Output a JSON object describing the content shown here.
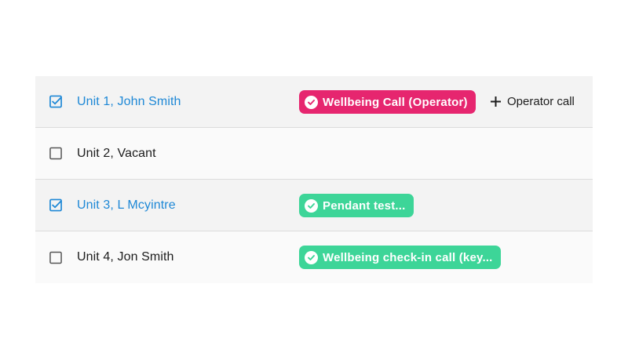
{
  "colors": {
    "accent_blue": "#1e88d6",
    "tag_pink": "#e6266f",
    "tag_green": "#3dd598",
    "row_selected_bg": "#f3f3f3"
  },
  "rows": [
    {
      "name": "Unit 1, John Smith",
      "checked": true,
      "tag": {
        "label": "Wellbeing Call (Operator)",
        "color": "#e6266f",
        "icon": "check-circle-icon"
      },
      "action": {
        "label": "Operator call",
        "icon": "plus-icon"
      }
    },
    {
      "name": "Unit 2, Vacant",
      "checked": false
    },
    {
      "name": "Unit 3, L Mcyintre",
      "checked": true,
      "tag": {
        "label": "Pendant test...",
        "color": "#3dd598",
        "icon": "check-circle-icon"
      }
    },
    {
      "name": "Unit 4, Jon Smith",
      "checked": false,
      "tag": {
        "label": "Wellbeing check-in call (key...",
        "color": "#3dd598",
        "icon": "check-circle-icon"
      }
    }
  ]
}
